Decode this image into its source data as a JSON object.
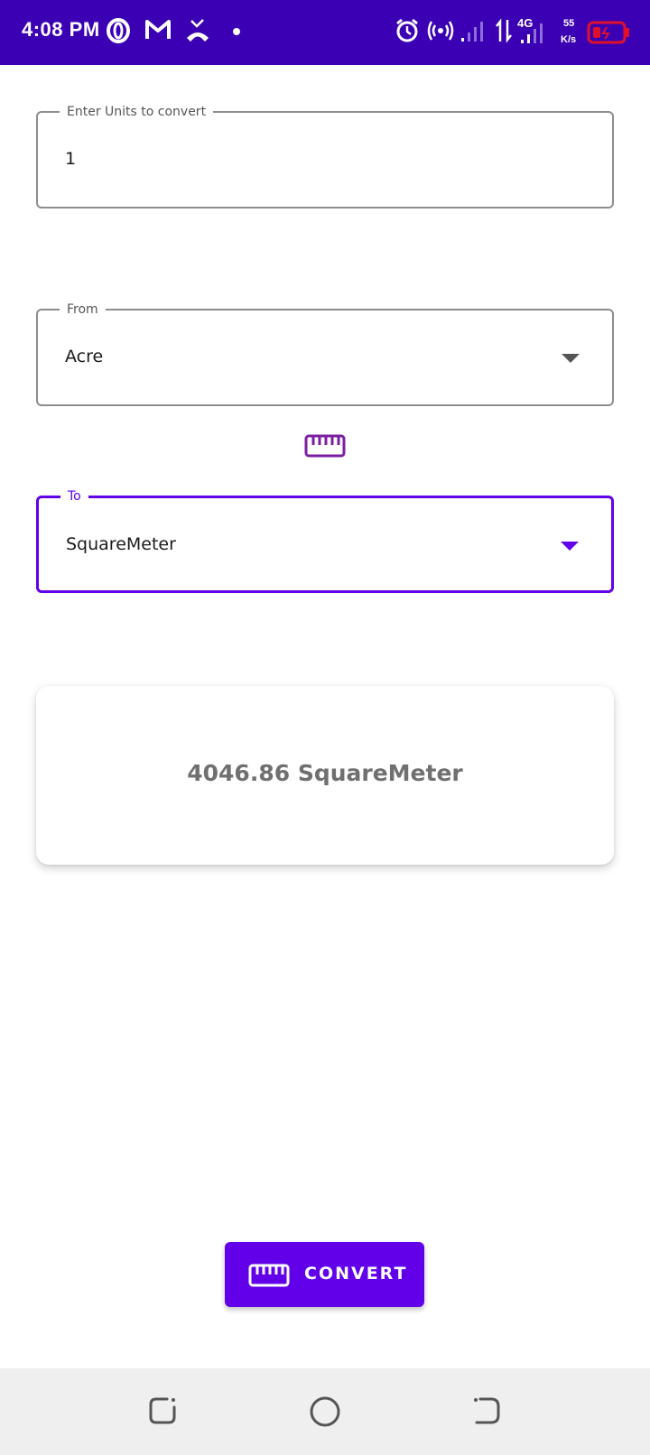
{
  "status_bar": {
    "time": "4:08 PM",
    "network_type": "4G",
    "speed_value": "55",
    "speed_unit": "K/s",
    "background_color": "#3b00b3",
    "icons": [
      "opera-icon",
      "gmail-icon",
      "missed-call-icon",
      "dot-icon",
      "alarm-icon",
      "hotspot-icon",
      "signal-icon",
      "data-arrows-icon",
      "signal-4g-icon",
      "battery-low-icon"
    ]
  },
  "input": {
    "label": "Enter Units to convert",
    "value": "1"
  },
  "from": {
    "label": "From",
    "value": "Acre"
  },
  "swap_icon": "ruler-icon",
  "to": {
    "label": "To",
    "value": "SquareMeter"
  },
  "result": {
    "text": "4046.86 SquareMeter"
  },
  "convert_button": {
    "label": "CONVERT",
    "icon": "ruler-icon"
  },
  "nav_bar": {
    "buttons": [
      "recents-icon",
      "home-icon",
      "back-icon"
    ]
  },
  "colors": {
    "accent": "#6200ea",
    "status_bar": "#3b00b3",
    "battery": "#e0102a"
  }
}
